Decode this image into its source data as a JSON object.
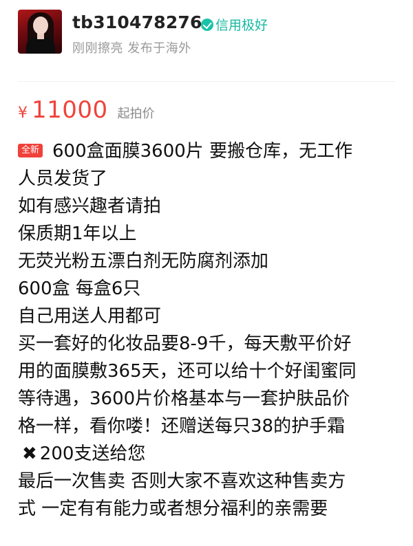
{
  "seller": {
    "username": "tb310478276",
    "credit_label": "信用极好",
    "subinfo": "刚刚擦亮 发布于海外"
  },
  "price": {
    "symbol": "¥",
    "value": "11000",
    "note": "起拍价"
  },
  "description": {
    "badge": "全新",
    "lines": [
      "600盒面膜3600片 要搬仓库，无工作",
      "人员发货了",
      "如有感兴趣者请拍",
      "保质期1年以上",
      "无荧光粉五漂白剂无防腐剂添加",
      "600盒 每盒6只",
      "自己用送人用都可",
      "买一套好的化妆品要8-9千，每天敷平价好",
      "用的面膜敷365天，还可以给十个好闺蜜同",
      "等待遇，3600片价格基本与一套护肤品价",
      "格一样，看你喽！还赠送每只38的护手霜",
      "200支送给您",
      "最后一次售卖 否则大家不喜欢这种售卖方",
      "式 一定有有能力或者想分福利的亲需要"
    ]
  },
  "colors": {
    "price": "#f0433b",
    "badge": "#f0403a",
    "credit": "#19b8a0",
    "muted": "#9a9a9a"
  },
  "icons": {
    "credit": "check-circle-icon",
    "cross": "cross-icon"
  }
}
